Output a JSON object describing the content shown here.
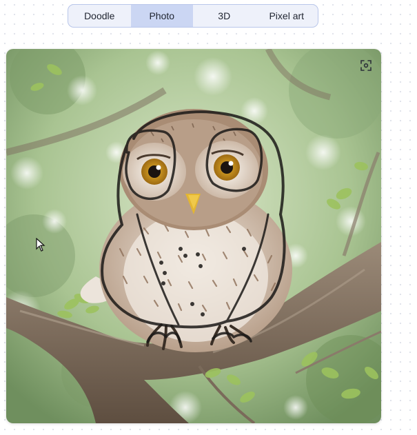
{
  "segmented_control": {
    "options": [
      "Doodle",
      "Photo",
      "3D",
      "Pixel art"
    ],
    "selected": "Photo"
  },
  "canvas": {
    "image": "owl-on-branch-photo",
    "overlay": "doodle-sketch-outline",
    "expand_icon": "expand-icon"
  }
}
